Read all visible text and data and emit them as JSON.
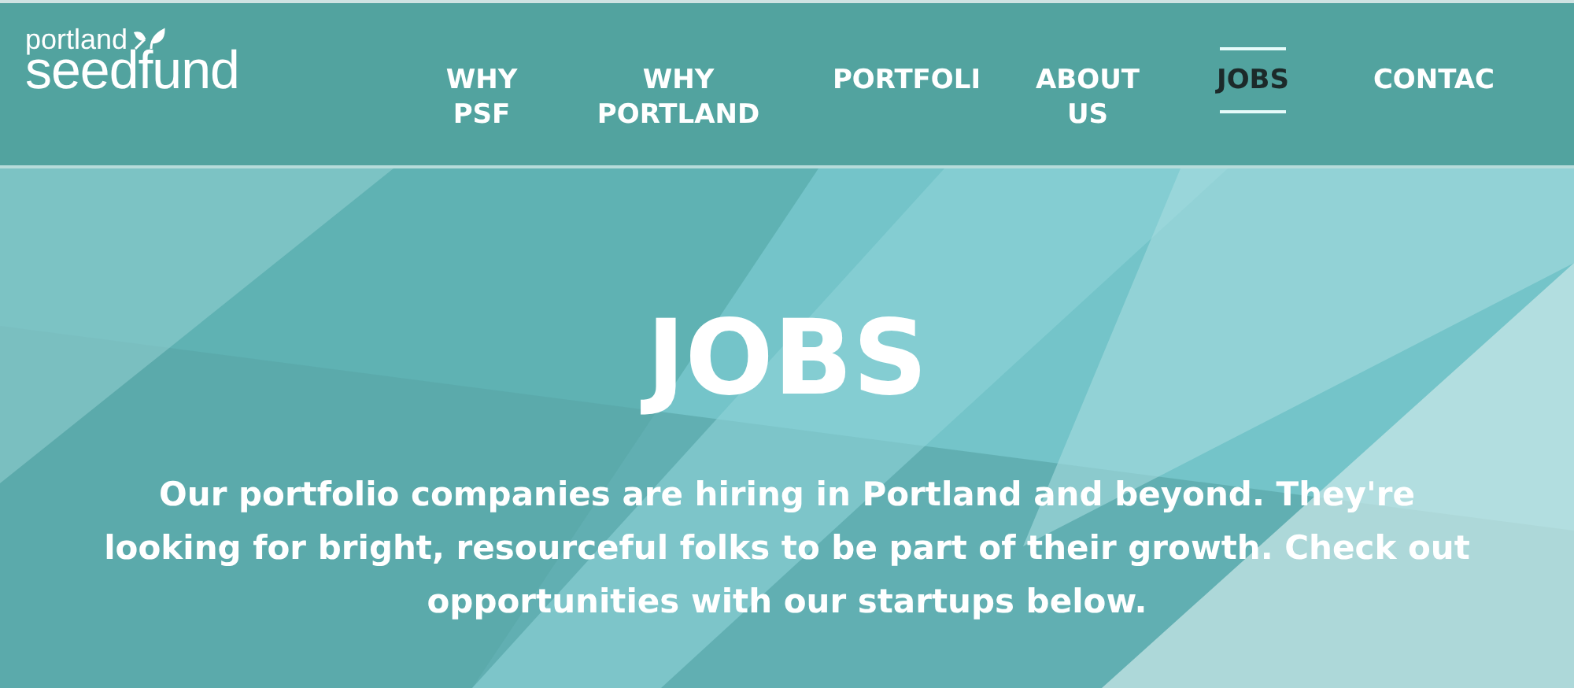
{
  "header": {
    "logo": {
      "top": "portland",
      "bottom": "seedfund"
    },
    "nav": [
      {
        "label": "WHY\nPSF",
        "selected": false
      },
      {
        "label": "WHY\nPORTLAND",
        "selected": false
      },
      {
        "label": "PORTFOLI",
        "selected": false
      },
      {
        "label": "ABOUT\nUS",
        "selected": false
      },
      {
        "label": "JOBS",
        "selected": true
      },
      {
        "label": "CONTAC",
        "selected": false
      }
    ]
  },
  "hero": {
    "title": "JOBS",
    "text": "Our portfolio companies are hiring in Portland and beyond. They're looking for bright, resourceful folks to be part of their growth. Check out opportunities with our startups below."
  }
}
